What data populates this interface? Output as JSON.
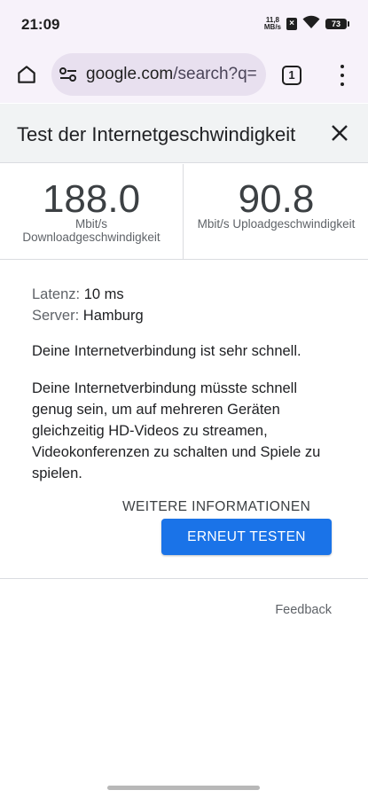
{
  "status_bar": {
    "time": "21:09",
    "net_speed_value": "11,8",
    "net_speed_unit": "MB/s",
    "battery": "73",
    "icons": [
      "sim-x-icon",
      "wifi-icon",
      "battery-icon"
    ]
  },
  "browser": {
    "url_domain": "google.com",
    "url_rest": "/search?q=",
    "tab_count": "1",
    "icons": [
      "home-icon",
      "tune-icon",
      "tabs-icon",
      "more-vert-icon"
    ]
  },
  "speed_test": {
    "title": "Test der Internetgeschwindigkeit",
    "download": {
      "value": "188.0",
      "unit_line1": "Mbit/s",
      "unit_line2": "Downloadgeschwindigkeit"
    },
    "upload": {
      "value": "90.8",
      "unit": "Mbit/s Uploadgeschwindigkeit"
    },
    "latency_label": "Latenz:",
    "latency_value": "10 ms",
    "server_label": "Server:",
    "server_value": "Hamburg",
    "message_short": "Deine Internetverbindung ist sehr schnell.",
    "message_long": "Deine Internetverbindung müsste schnell genug sein, um auf mehreren Geräten gleichzeitig HD-Videos zu streamen, Videokonferenzen zu schalten und Spiele zu spielen.",
    "more_info_label": "WEITERE INFORMATIONEN",
    "retest_label": "ERNEUT TESTEN",
    "feedback_label": "Feedback"
  },
  "colors": {
    "accent_button": "#1a73e8",
    "toolbar_bg": "#f7f2fa",
    "header_bg": "#f1f3f4"
  }
}
